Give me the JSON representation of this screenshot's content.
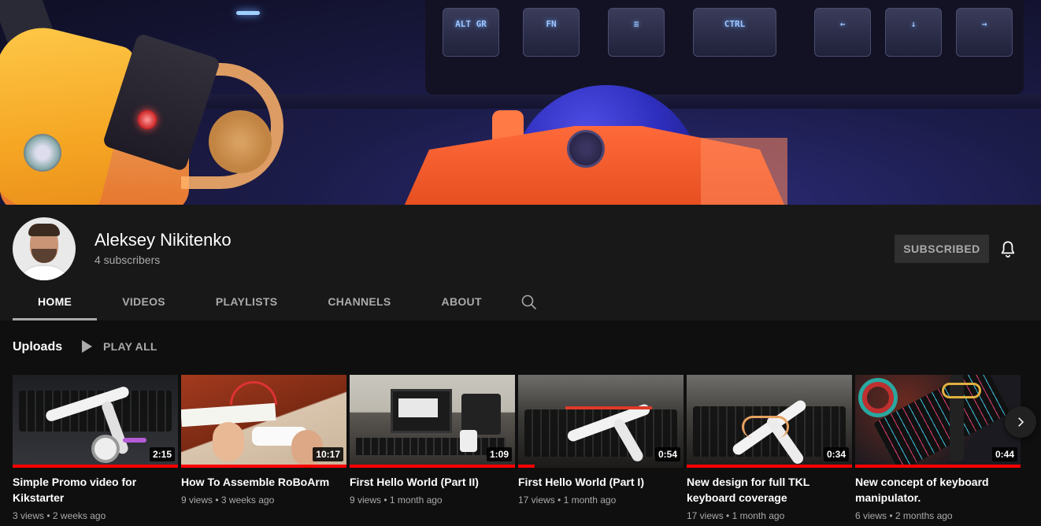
{
  "channel": {
    "name": "Aleksey Nikitenko",
    "subscribers": "4 subscribers",
    "subscribe_label": "SUBSCRIBED"
  },
  "banner": {
    "keys": [
      "ALT GR",
      "FN",
      "≡",
      "CTRL",
      "←",
      "↓",
      "→"
    ]
  },
  "tabs": [
    {
      "label": "HOME",
      "active": true
    },
    {
      "label": "VIDEOS",
      "active": false
    },
    {
      "label": "PLAYLISTS",
      "active": false
    },
    {
      "label": "CHANNELS",
      "active": false
    },
    {
      "label": "ABOUT",
      "active": false
    }
  ],
  "uploads": {
    "title": "Uploads",
    "play_all": "PLAY ALL",
    "videos": [
      {
        "title": "Simple Promo video for Kikstarter",
        "duration": "2:15",
        "views": "3 views",
        "age": "2 weeks ago"
      },
      {
        "title": "How To Assemble RoBoArm",
        "duration": "10:17",
        "views": "9 views",
        "age": "3 weeks ago"
      },
      {
        "title": "First Hello World (Part II)",
        "duration": "1:09",
        "views": "9 views",
        "age": "1 month ago"
      },
      {
        "title": "First Hello World (Part I)",
        "duration": "0:54",
        "views": "17 views",
        "age": "1 month ago"
      },
      {
        "title": "New design for full TKL keyboard coverage",
        "duration": "0:34",
        "views": "17 views",
        "age": "1 month ago"
      },
      {
        "title": "New concept of keyboard manipulator.",
        "duration": "0:44",
        "views": "6 views",
        "age": "2 months ago"
      }
    ]
  },
  "colors": {
    "background": "#181818",
    "progress_red": "#ff0000",
    "muted_text": "#aaaaaa"
  }
}
